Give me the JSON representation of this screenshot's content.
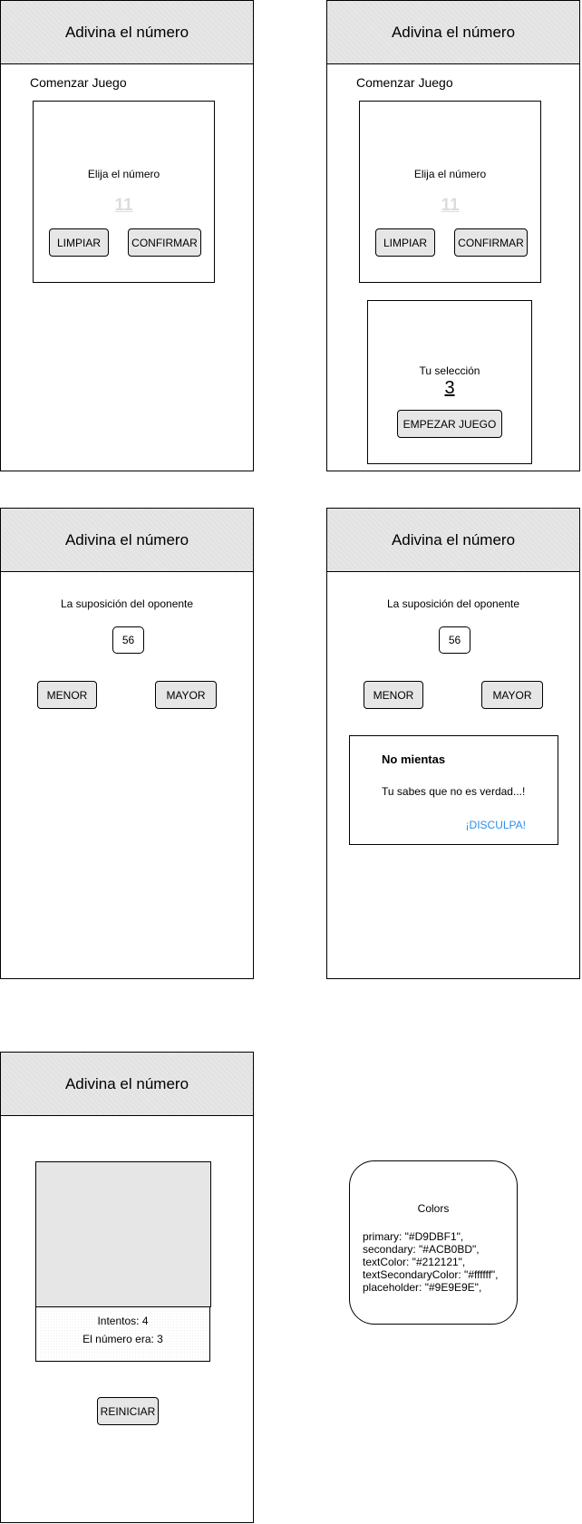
{
  "app_title": "Adivina el número",
  "start_screen": {
    "heading": "Comenzar Juego",
    "prompt": "Elija el número",
    "input_placeholder": "11",
    "clear_button": "LIMPIAR",
    "confirm_button": "CONFIRMAR"
  },
  "selection_card": {
    "label": "Tu selección",
    "value": "3",
    "start_button": "EMPEZAR JUEGO"
  },
  "game_screen": {
    "opponent_label": "La suposición del oponente",
    "guess": "56",
    "lower_button": "MENOR",
    "higher_button": "MAYOR"
  },
  "alert": {
    "title": "No mientas",
    "message": "Tu sabes que no es verdad...!",
    "action": "¡DISCULPA!"
  },
  "game_over": {
    "attempts": "Intentos: 4",
    "number_was": "El número era: 3",
    "restart_button": "REINICIAR"
  },
  "colors_note": {
    "title": "Colors",
    "lines": [
      "primary: \"#D9DBF1\",",
      "secondary: \"#ACB0BD\",",
      "textColor: \"#212121\",",
      "textSecondaryColor: \"#ffffff\",",
      "placeholder: \"#9E9E9E\","
    ]
  },
  "theme": {
    "header_bg": "#e6e6e6",
    "button_bg": "#e6e6e6",
    "link_color": "#2a8fe8",
    "placeholder_color": "#dcdcdc"
  }
}
